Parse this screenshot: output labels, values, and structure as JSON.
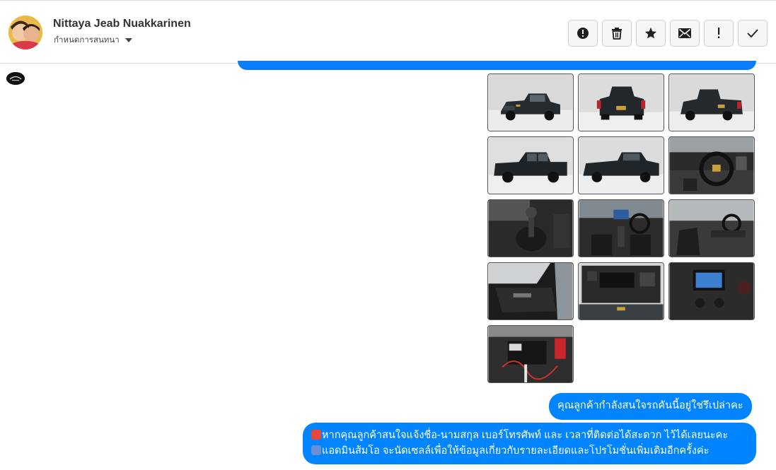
{
  "contact": {
    "name": "Nittaya Jeab Nuakkarinen",
    "conversation_menu": "กำหนดการสนทนา"
  },
  "actions": [
    {
      "icon": "alert-circle-icon"
    },
    {
      "icon": "trash-icon"
    },
    {
      "icon": "star-icon"
    },
    {
      "icon": "envelope-icon"
    },
    {
      "icon": "exclamation-icon"
    },
    {
      "icon": "check-icon"
    }
  ],
  "photos": [
    {
      "subject": "truck-front-three-quarter"
    },
    {
      "subject": "truck-rear"
    },
    {
      "subject": "truck-rear-three-quarter"
    },
    {
      "subject": "truck-side"
    },
    {
      "subject": "truck-side-front"
    },
    {
      "subject": "interior-steering-wheel"
    },
    {
      "subject": "interior-gear-shift"
    },
    {
      "subject": "interior-dashboard"
    },
    {
      "subject": "interior-front-seats"
    },
    {
      "subject": "door-panel"
    },
    {
      "subject": "engine-bay"
    },
    {
      "subject": "infotainment-screen"
    },
    {
      "subject": "battery"
    }
  ],
  "messages": [
    {
      "text": "คุณลูกค้ากำลังสนใจรถคันนี้อยู่ใช่รึเปล่าคะ"
    },
    {
      "line1": "หากคุณลูกค้าสนใจแจ้งชื่อ-นามสกุล เบอร์โทรศัพท์ และ เวลาที่ติดต่อได้สะดวก ไว้ได้เลยนะคะ",
      "line2": "แอดมินส้มโอ จะนัดเซลล์เพื่อให้ข้อมูลเกี่ยวกับรายละเอียดและโปรโมชั่นเพิ่มเติมอีกครั้งค่ะ"
    }
  ],
  "colors": {
    "bubble": "#0084ff",
    "header_text": "#333333"
  }
}
